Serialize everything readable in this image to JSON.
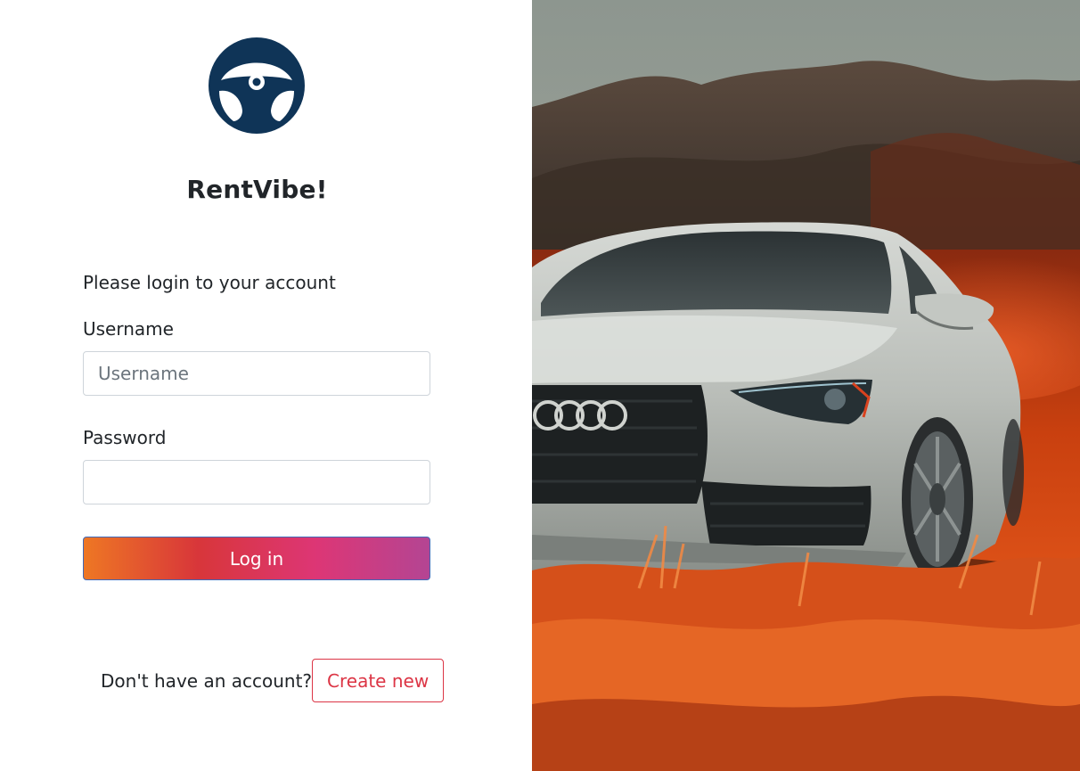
{
  "brand": {
    "name": "RentVibe!",
    "logo_icon": "steering-wheel-icon",
    "logo_color": "#0f3457",
    "logo_arc_color": "#555555"
  },
  "login": {
    "prompt": "Please login to your account",
    "username_label": "Username",
    "username_placeholder": "Username",
    "username_value": "",
    "password_label": "Password",
    "password_value": "",
    "login_button": "Log in"
  },
  "signup": {
    "text": "Don't have an account?",
    "button": "Create new"
  },
  "colors": {
    "gradient": [
      "#ee7724",
      "#d8363a",
      "#dd3675",
      "#b44593"
    ],
    "danger": "#dc3545"
  }
}
